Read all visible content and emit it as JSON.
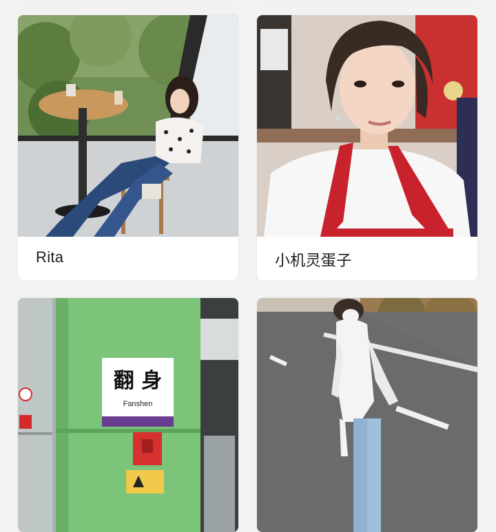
{
  "cards": [
    {
      "name": "Rita",
      "photo_icon": "cafe-window-portrait-photo"
    },
    {
      "name": "小机灵蛋子",
      "photo_icon": "selfie-portrait-photo"
    },
    {
      "name": "",
      "photo_icon": "subway-station-photo",
      "sign_text": "翻 身",
      "sign_pinyin": "Fanshen"
    },
    {
      "name": "",
      "photo_icon": "street-portrait-photo"
    }
  ],
  "colors": {
    "background": "#f2f2f2",
    "card": "#ffffff",
    "text": "#1a1a1a",
    "subway_green": "#7cc47a",
    "apron_red": "#c8232c"
  }
}
